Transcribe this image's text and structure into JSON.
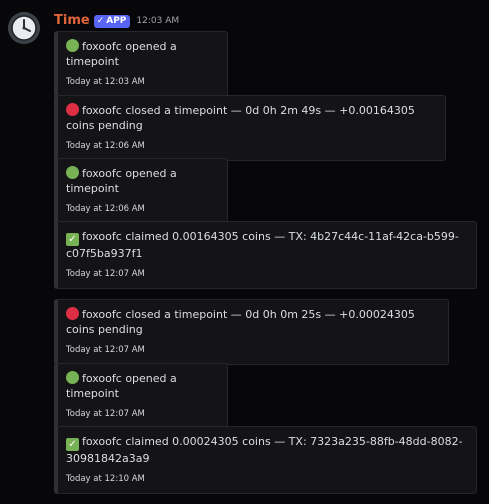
{
  "message": {
    "username": "Time",
    "badge": "APP",
    "badge_check": "✓",
    "timestamp": "12:03 AM",
    "avatar_icon": "clock-icon"
  },
  "colors": {
    "username": "#e0653b",
    "badge": "#5865f2",
    "green": "#77b255",
    "red": "#dd2e44"
  },
  "embeds": [
    {
      "icon": "green-circle-icon",
      "text": "foxoofc opened a timepoint",
      "footer": "Today at 12:03 AM"
    },
    {
      "icon": "red-circle-icon",
      "text": "foxoofc closed a timepoint — 0d 0h 2m 49s — +0.00164305 coins pending",
      "footer": "Today at 12:06 AM"
    },
    {
      "icon": "green-circle-icon",
      "text": "foxoofc opened a timepoint",
      "footer": "Today at 12:06 AM"
    },
    {
      "icon": "check-mark-icon",
      "text": "foxoofc claimed 0.00164305 coins — TX: 4b27c44c-11af-42ca-b599-c07f5ba937f1",
      "footer": "Today at 12:07 AM"
    },
    {
      "icon": "red-circle-icon",
      "text": "foxoofc closed a timepoint — 0d 0h 0m 25s — +0.00024305 coins pending",
      "footer": "Today at 12:07 AM"
    },
    {
      "icon": "green-circle-icon",
      "text": "foxoofc opened a timepoint",
      "footer": "Today at 12:07 AM"
    },
    {
      "icon": "check-mark-icon",
      "text": "foxoofc claimed 0.00024305 coins — TX: 7323a235-88fb-48dd-8082-30981842a3a9",
      "footer": "Today at 12:10 AM"
    }
  ]
}
